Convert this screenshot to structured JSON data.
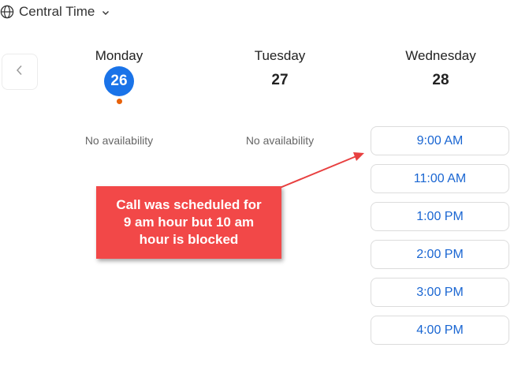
{
  "timezone": {
    "label": "Central Time",
    "icon": "globe-icon"
  },
  "nav": {
    "prev_icon": "chevron-left-icon"
  },
  "days": [
    {
      "name": "Monday",
      "date": "26",
      "selected": true,
      "availability": "No availability"
    },
    {
      "name": "Tuesday",
      "date": "27",
      "selected": false,
      "availability": "No availability"
    },
    {
      "name": "Wednesday",
      "date": "28",
      "selected": false
    }
  ],
  "slots": [
    "9:00 AM",
    "11:00 AM",
    "1:00 PM",
    "2:00 PM",
    "3:00 PM",
    "4:00 PM"
  ],
  "annotation": {
    "lines": [
      "Call was scheduled for",
      "9 am hour but 10 am",
      "hour is blocked"
    ],
    "color": "#f24848"
  },
  "colors": {
    "accent": "#1a73e8",
    "slot_text": "#1a66d2",
    "today_dot": "#e8620a"
  }
}
